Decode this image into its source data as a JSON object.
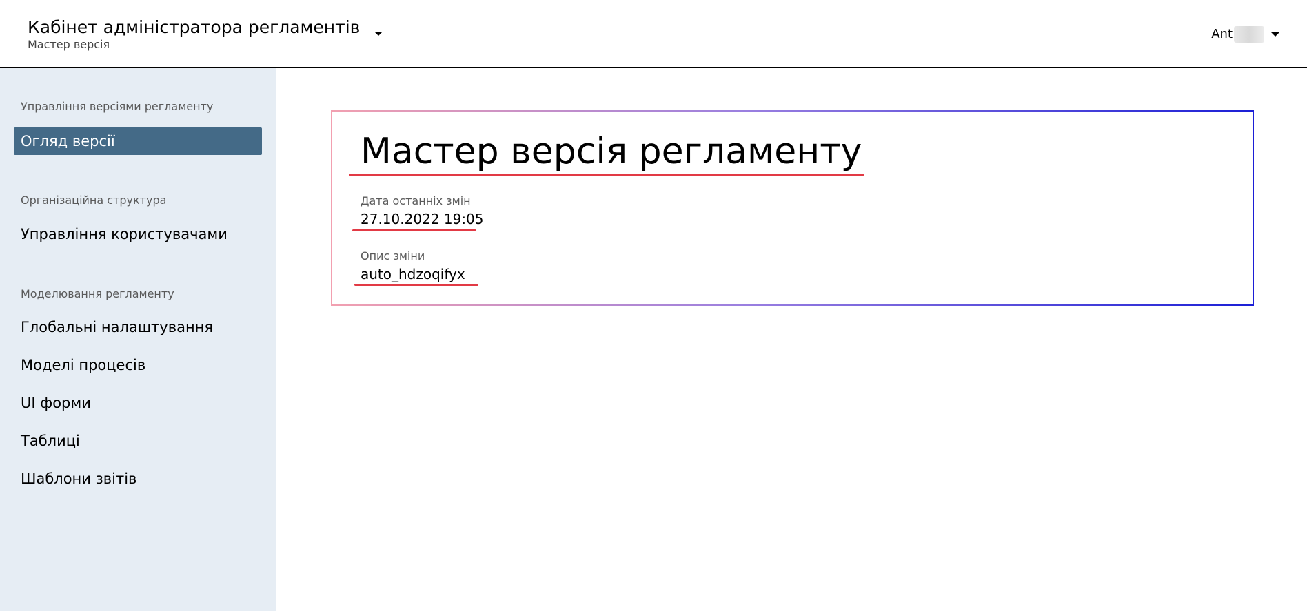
{
  "header": {
    "app_title": "Кабінет адміністратора регламентів",
    "app_subtitle": "Мастер версія",
    "user_name": "Ant"
  },
  "sidebar": {
    "sections": [
      {
        "title": "Управління версіями регламенту",
        "items": [
          {
            "label": "Огляд версії",
            "active": true
          }
        ]
      },
      {
        "title": "Організаційна структура",
        "items": [
          {
            "label": "Управління користувачами",
            "active": false
          }
        ]
      },
      {
        "title": "Моделювання регламенту",
        "items": [
          {
            "label": "Глобальні налаштування",
            "active": false
          },
          {
            "label": "Моделі процесів",
            "active": false
          },
          {
            "label": "UI форми",
            "active": false
          },
          {
            "label": "Таблиці",
            "active": false
          },
          {
            "label": "Шаблони звітів",
            "active": false
          }
        ]
      }
    ]
  },
  "main": {
    "card": {
      "title": "Мастер версія регламенту",
      "fields": [
        {
          "label": "Дата останніх змін",
          "value": "27.10.2022 19:05"
        },
        {
          "label": "Опис зміни",
          "value": "auto_hdzoqifyx"
        }
      ]
    }
  },
  "colors": {
    "header_border": "#000000",
    "sidebar_background": "#e6edf4",
    "active_item_background": "#446a87",
    "active_item_text": "#ffffff",
    "card_border_start": "#f2a0b0",
    "card_border_end": "#1b1fd6",
    "annotation_underline": "#e23a45"
  },
  "icons": {
    "app_switcher": "caret-down-icon",
    "user_menu": "caret-down-icon"
  }
}
